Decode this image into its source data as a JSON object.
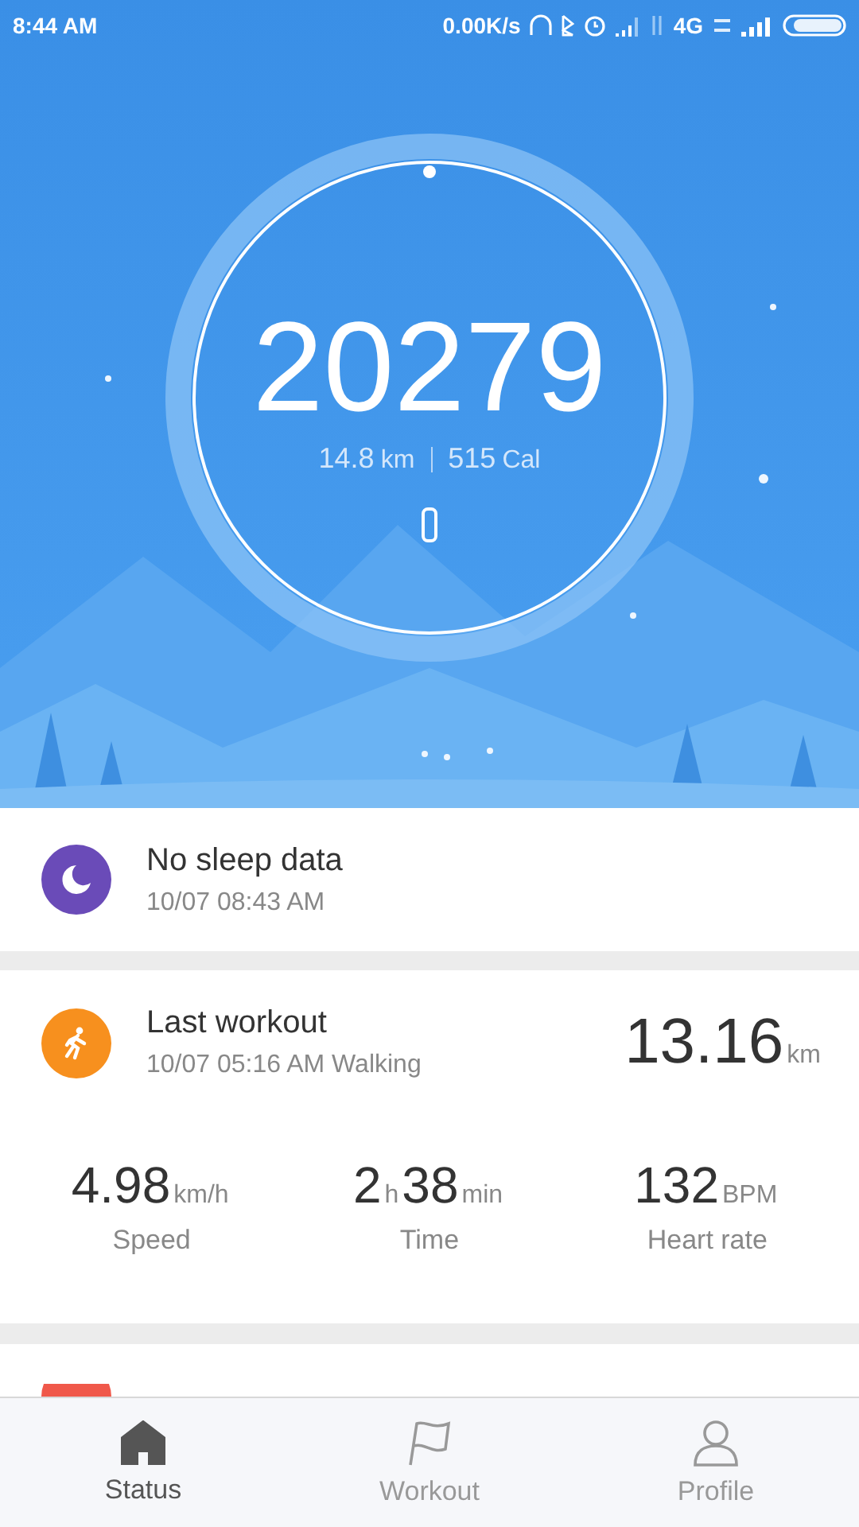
{
  "status_bar": {
    "time": "8:44 AM",
    "net_speed": "0.00K/s",
    "network": "4G"
  },
  "summary": {
    "steps": "20279",
    "distance": "14.8",
    "distance_unit": "km",
    "calories": "515",
    "calories_unit": "Cal"
  },
  "sleep": {
    "title": "No sleep data",
    "time": "10/07 08:43 AM"
  },
  "workout": {
    "title": "Last workout",
    "detail": "10/07 05:16 AM Walking",
    "distance": "13.16",
    "distance_unit": "km",
    "stats": [
      {
        "parts": [
          {
            "kind": "value",
            "text": "4.98"
          },
          {
            "kind": "unit",
            "text": "km/h"
          }
        ],
        "label": "Speed"
      },
      {
        "parts": [
          {
            "kind": "value",
            "text": "2"
          },
          {
            "kind": "unit",
            "text": "h"
          },
          {
            "kind": "value",
            "text": "38"
          },
          {
            "kind": "unit",
            "text": "min"
          }
        ],
        "label": "Time"
      },
      {
        "parts": [
          {
            "kind": "value",
            "text": "132"
          },
          {
            "kind": "unit",
            "text": "BPM"
          }
        ],
        "label": "Heart rate"
      }
    ]
  },
  "nav": [
    {
      "kind": "home",
      "label": "Status",
      "selected": true
    },
    {
      "kind": "flag",
      "label": "Workout",
      "selected": false
    },
    {
      "kind": "person",
      "label": "Profile",
      "selected": false
    }
  ]
}
